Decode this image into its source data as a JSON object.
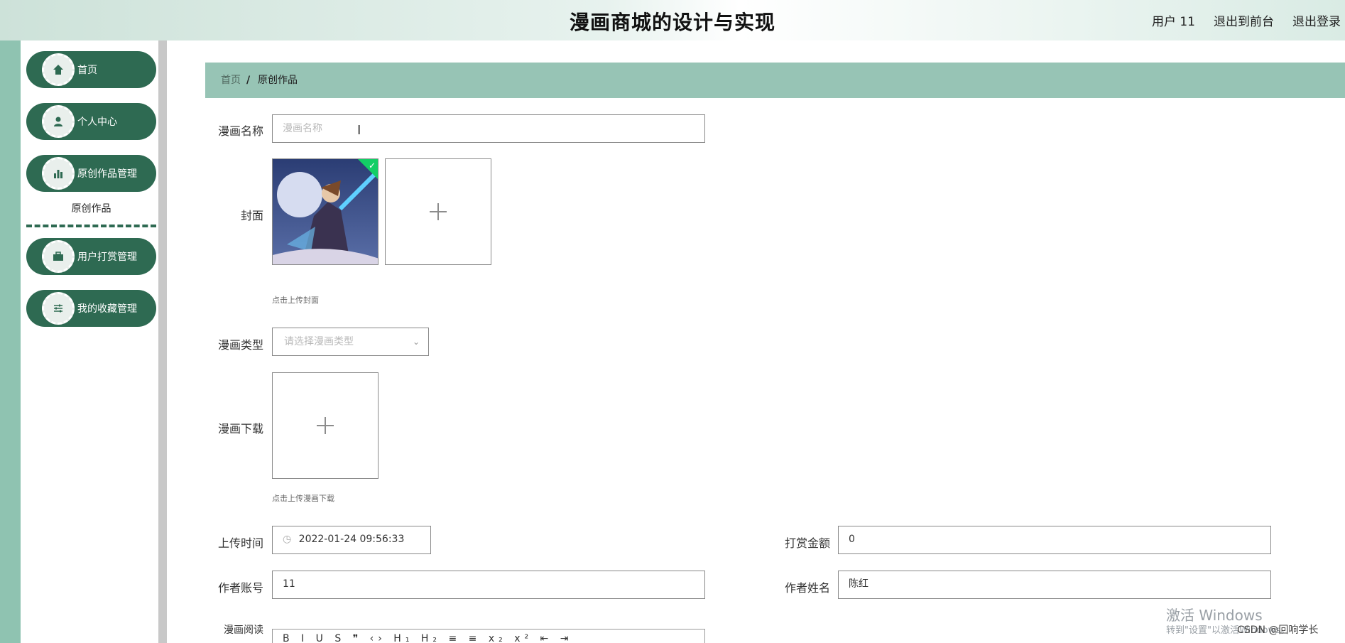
{
  "header": {
    "title": "漫画商城的设计与实现",
    "user_label": "用户 11",
    "to_front_label": "退出到前台",
    "logout_label": "退出登录"
  },
  "sidebar": {
    "items": [
      {
        "label": "首页",
        "icon": "home-icon"
      },
      {
        "label": "个人中心",
        "icon": "user-icon"
      },
      {
        "label": "原创作品管理",
        "icon": "bar-chart-icon"
      },
      {
        "label": "用户打赏管理",
        "icon": "briefcase-icon"
      },
      {
        "label": "我的收藏管理",
        "icon": "sliders-icon"
      }
    ],
    "sub_item_label": "原创作品"
  },
  "breadcrumb": {
    "home": "首页",
    "separator": "/",
    "current": "原创作品"
  },
  "form": {
    "name_label": "漫画名称",
    "name_placeholder": "漫画名称",
    "cover_label": "封面",
    "cover_hint": "点击上传封面",
    "type_label": "漫画类型",
    "type_placeholder": "请选择漫画类型",
    "download_label": "漫画下载",
    "download_hint": "点击上传漫画下载",
    "upload_time_label": "上传时间",
    "upload_time_value": "2022-01-24 09:56:33",
    "reward_label": "打赏金额",
    "reward_value": "0",
    "author_account_label": "作者账号",
    "author_account_value": "11",
    "author_name_label": "作者姓名",
    "author_name_value": "陈红",
    "read_label": "漫画阅读"
  },
  "editor_toolbar": "B I U S ❞ ‹› H₁ H₂ ≡ ≡ x₂ x² ⇤ ⇥",
  "overlay": {
    "activate_title": "激活 Windows",
    "activate_sub": "转到\"设置\"以激活Windows。",
    "csdn_mark": "CSDN @回响学长"
  },
  "colors": {
    "sidebar_green": "#2e6a52",
    "breadcrumb_green": "#97c4b5",
    "left_rail": "#8fc3b1",
    "success_badge": "#13ce66"
  }
}
